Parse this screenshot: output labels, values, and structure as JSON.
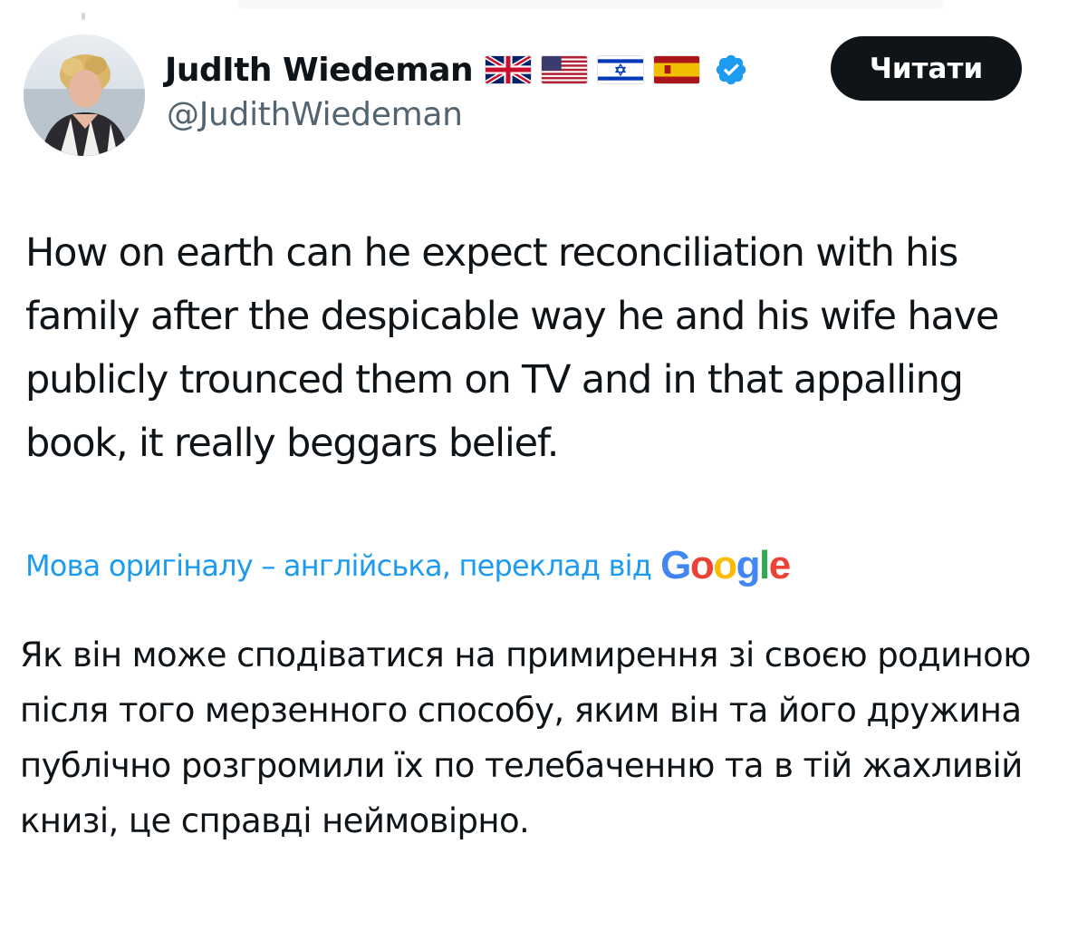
{
  "user": {
    "display_name": "JudIth Wiedeman",
    "handle": "@JudithWiedeman",
    "flags": [
      "flag-uk",
      "flag-usa",
      "flag-israel",
      "flag-spain"
    ],
    "verified": true,
    "avatar": "profile-photo"
  },
  "follow_button": {
    "label": "Читати"
  },
  "tweet": {
    "text": "How on earth can he expect reconciliation with his family after the despicable way he and his wife have publicly trounced them on TV and in that appalling book, it really beggars belief."
  },
  "translation": {
    "note": "Мова оригіналу – англійська, переклад від",
    "provider": "Google",
    "text": "Як він може сподіватися на примирення зі своєю родиною після того мерзенного способу, яким він та його дружина публічно розгромили їх по телебаченню та в тій жахливій книзі, це справді неймовірно."
  },
  "colors": {
    "text": "#0f1419",
    "secondary_text": "#536471",
    "link": "#1d9bf0",
    "button_bg": "#0f1419",
    "button_text": "#ffffff",
    "verified_badge": "#1d9bf0"
  }
}
